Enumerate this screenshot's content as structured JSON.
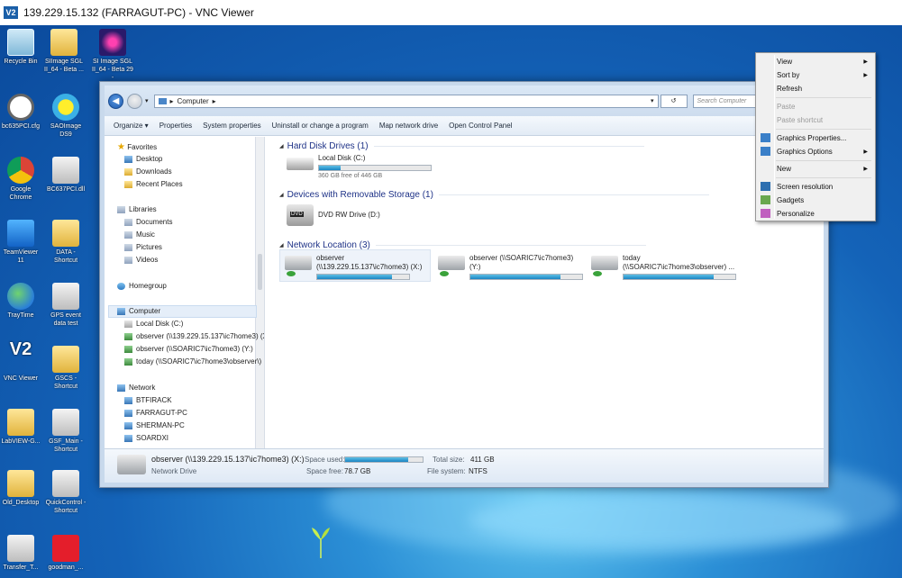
{
  "vnc": {
    "title": "139.229.15.132 (FARRAGUT-PC) - VNC Viewer",
    "logo": "V2"
  },
  "desktop_icons": [
    {
      "label": "Recycle Bin"
    },
    {
      "label": "SIImage SGL II_64 - Beta ..."
    },
    {
      "label": "SI Image SGL II_64 - Beta 29 -"
    },
    {
      "label": "bc635PCI.cfg"
    },
    {
      "label": "SAOImage DS9"
    },
    {
      "label": "Google Chrome"
    },
    {
      "label": "BC637PCI.dll"
    },
    {
      "label": "TeamViewer 11"
    },
    {
      "label": "DATA - Shortcut"
    },
    {
      "label": "TrayTime"
    },
    {
      "label": "GPS event data test"
    },
    {
      "label": "VNC Viewer"
    },
    {
      "label": "GSCS - Shortcut"
    },
    {
      "label": "LabVIEW-G..."
    },
    {
      "label": "GSF_Main - Shortcut"
    },
    {
      "label": "Old_Desktop"
    },
    {
      "label": "QuickControl - Shortcut"
    },
    {
      "label": "Transfer_T..."
    },
    {
      "label": "goodman_..."
    }
  ],
  "explorer": {
    "breadcrumb": [
      "Computer"
    ],
    "search_placeholder": "Search Computer",
    "toolbar": [
      "Organize ▾",
      "Properties",
      "System properties",
      "Uninstall or change a program",
      "Map network drive",
      "Open Control Panel"
    ],
    "nav": {
      "favorites": "Favorites",
      "fav_items": [
        "Desktop",
        "Downloads",
        "Recent Places"
      ],
      "libraries": "Libraries",
      "lib_items": [
        "Documents",
        "Music",
        "Pictures",
        "Videos"
      ],
      "homegroup": "Homegroup",
      "computer": "Computer",
      "comp_items": [
        "Local Disk (C:)",
        "observer (\\\\139.229.15.137\\ic7home3) (X:)",
        "observer (\\\\SOARIC7\\ic7home3) (Y:)",
        "today (\\\\SOARIC7\\ic7home3\\observer\\)"
      ],
      "network": "Network",
      "net_items": [
        "BTFIRACK",
        "FARRAGUT-PC",
        "SHERMAN-PC",
        "SOARDXI"
      ]
    },
    "sections": {
      "hdd": "Hard Disk Drives (1)",
      "removable": "Devices with Removable Storage (1)",
      "network": "Network Location (3)"
    },
    "local_disk": {
      "name": "Local Disk (C:)",
      "free": "360 GB free of 446 GB",
      "used_fraction": 0.19
    },
    "dvd": {
      "name": "DVD RW Drive (D:)"
    },
    "net_drives": [
      {
        "line1": "observer",
        "line2": "(\\\\139.229.15.137\\ic7home3) (X:)",
        "used_fraction": 0.81
      },
      {
        "line1": "observer (\\\\SOARIC7\\ic7home3)",
        "line2": "(Y:)",
        "used_fraction": 0.81
      },
      {
        "line1": "today",
        "line2": "(\\\\SOARIC7\\ic7home3\\observer) ...",
        "used_fraction": 0.81
      }
    ],
    "details": {
      "name": "observer (\\\\139.229.15.137\\ic7home3) (X:)",
      "type": "Network Drive",
      "space_used_label": "Space used:",
      "space_used_fraction": 0.81,
      "space_free_label": "Space free:",
      "space_free": "78.7 GB",
      "total_size_label": "Total size:",
      "total_size": "411 GB",
      "fs_label": "File system:",
      "fs": "NTFS"
    }
  },
  "context_menu": {
    "items": [
      "View",
      "Sort by",
      "Refresh",
      "Paste",
      "Paste shortcut",
      "Graphics Properties...",
      "Graphics Options",
      "New",
      "Screen resolution",
      "Gadgets",
      "Personalize"
    ]
  }
}
